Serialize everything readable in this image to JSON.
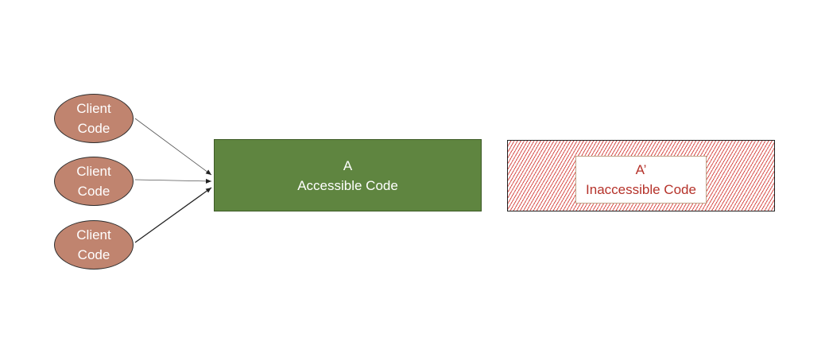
{
  "diagram": {
    "clients": [
      {
        "line1": "Client",
        "line2": "Code"
      },
      {
        "line1": "Client",
        "line2": "Code"
      },
      {
        "line1": "Client",
        "line2": "Code"
      }
    ],
    "accessible": {
      "line1": "A",
      "line2": "Accessible Code"
    },
    "inaccessible": {
      "line1": "A’",
      "line2": "Inaccessible Code"
    }
  },
  "colors": {
    "client_fill": "#c0846f",
    "accessible_fill": "#5f8540",
    "inaccessible_text": "#b5322a",
    "hatch": "#d9534f"
  }
}
